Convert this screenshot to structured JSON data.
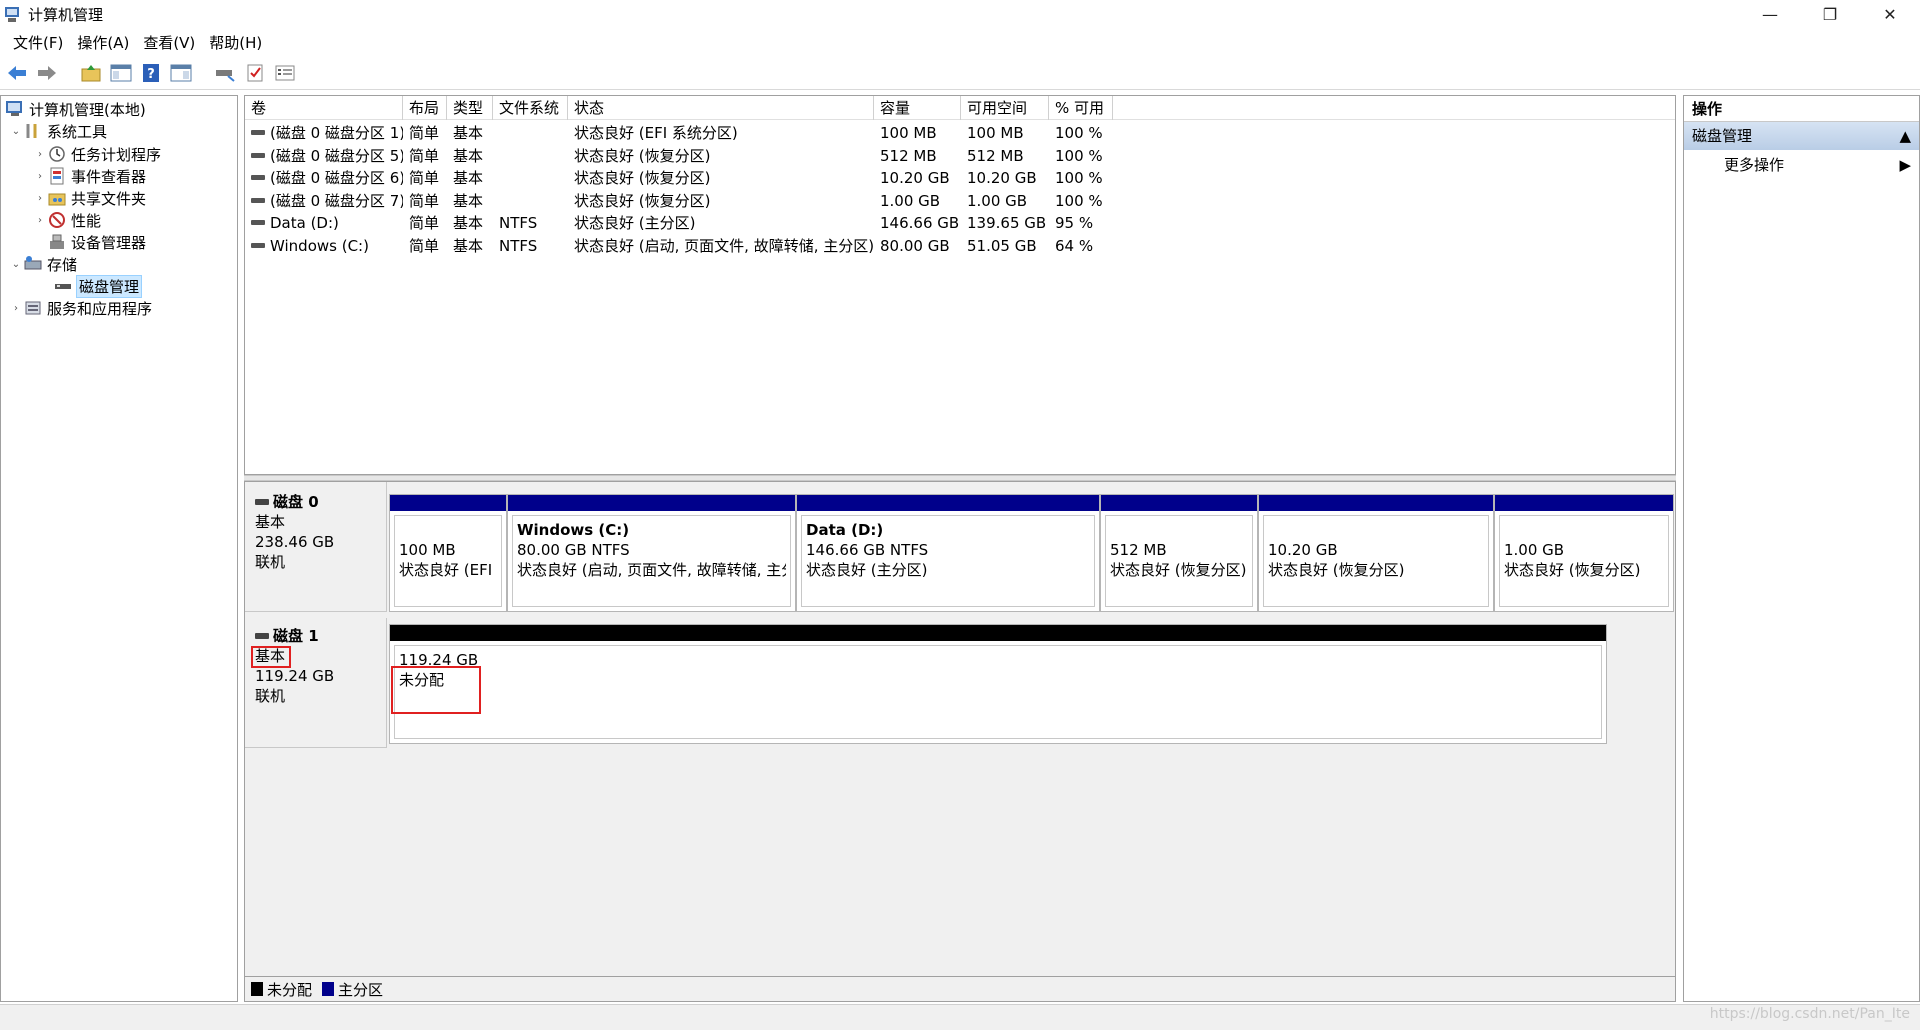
{
  "window": {
    "title": "计算机管理",
    "minimize": "—",
    "maximize": "❐",
    "close": "✕"
  },
  "menu": [
    "文件(F)",
    "操作(A)",
    "查看(V)",
    "帮助(H)"
  ],
  "tree": {
    "root": "计算机管理(本地)",
    "system_tools": "系统工具",
    "task_scheduler": "任务计划程序",
    "event_viewer": "事件查看器",
    "shared_folders": "共享文件夹",
    "performance": "性能",
    "device_manager": "设备管理器",
    "storage": "存储",
    "disk_management": "磁盘管理",
    "services_apps": "服务和应用程序"
  },
  "volume_table": {
    "headers": [
      "卷",
      "布局",
      "类型",
      "文件系统",
      "状态",
      "容量",
      "可用空间",
      "% 可用"
    ],
    "rows": [
      [
        "(磁盘 0 磁盘分区 1)",
        "简单",
        "基本",
        "",
        "状态良好 (EFI 系统分区)",
        "100 MB",
        "100 MB",
        "100 %"
      ],
      [
        "(磁盘 0 磁盘分区 5)",
        "简单",
        "基本",
        "",
        "状态良好 (恢复分区)",
        "512 MB",
        "512 MB",
        "100 %"
      ],
      [
        "(磁盘 0 磁盘分区 6)",
        "简单",
        "基本",
        "",
        "状态良好 (恢复分区)",
        "10.20 GB",
        "10.20 GB",
        "100 %"
      ],
      [
        "(磁盘 0 磁盘分区 7)",
        "简单",
        "基本",
        "",
        "状态良好 (恢复分区)",
        "1.00 GB",
        "1.00 GB",
        "100 %"
      ],
      [
        "Data (D:)",
        "简单",
        "基本",
        "NTFS",
        "状态良好 (主分区)",
        "146.66 GB",
        "139.65 GB",
        "95 %"
      ],
      [
        "Windows (C:)",
        "简单",
        "基本",
        "NTFS",
        "状态良好 (启动, 页面文件, 故障转储, 主分区)",
        "80.00 GB",
        "51.05 GB",
        "64 %"
      ]
    ]
  },
  "disk0": {
    "name": "磁盘 0",
    "type": "基本",
    "size": "238.46 GB",
    "status": "联机",
    "partitions": [
      {
        "title": "",
        "size": "100 MB",
        "status": "状态良好 (EFI 系统分区)"
      },
      {
        "title": "Windows  (C:)",
        "size": "80.00 GB NTFS",
        "status": "状态良好 (启动, 页面文件, 故障转储, 主分区)"
      },
      {
        "title": "Data  (D:)",
        "size": "146.66 GB NTFS",
        "status": "状态良好 (主分区)"
      },
      {
        "title": "",
        "size": "512 MB",
        "status": "状态良好 (恢复分区)"
      },
      {
        "title": "",
        "size": "10.20 GB",
        "status": "状态良好 (恢复分区)"
      },
      {
        "title": "",
        "size": "1.00 GB",
        "status": "状态良好 (恢复分区)"
      }
    ]
  },
  "disk1": {
    "name": "磁盘 1",
    "type": "基本",
    "size": "119.24 GB",
    "status": "联机",
    "unallocated": {
      "size": "119.24 GB",
      "label": "未分配"
    }
  },
  "legend": {
    "unallocated": "未分配",
    "primary": "主分区",
    "unallocated_color": "#000000",
    "primary_color": "#00008b"
  },
  "actions": {
    "header": "操作",
    "section": "磁盘管理",
    "more": "更多操作"
  },
  "watermark": "https://blog.csdn.net/Pan_Ite"
}
